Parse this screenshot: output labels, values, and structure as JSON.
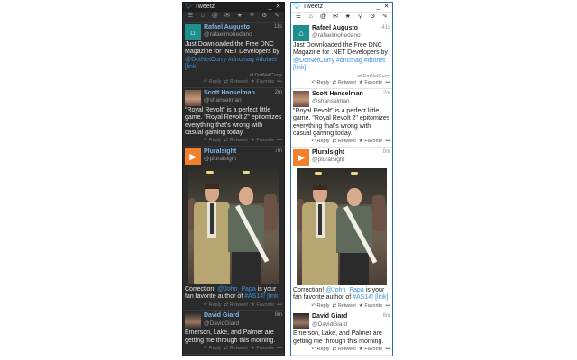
{
  "app": {
    "title": "Tweetz"
  },
  "titlebar": {
    "minimize_glyph": "_",
    "close_glyph": "✕"
  },
  "toolbar": {
    "icons": [
      "list-icon",
      "home-icon",
      "mentions-icon",
      "messages-icon",
      "favorites-icon",
      "search-icon",
      "settings-icon",
      "compose-icon"
    ]
  },
  "action_labels": {
    "reply": "Reply",
    "retweet": "Retweet",
    "favorite": "Favorite",
    "more": "•••"
  },
  "windows": [
    {
      "theme": "dark",
      "tweets": [
        {
          "name": "Rafael Augusto",
          "handle": "@rafaelmohedano",
          "time": "11s",
          "text_before": "Just Downloaded the Free DNC Magazine for .NET Developers by ",
          "link1": "@DotNetCurry #dncmag #dotnet",
          "link2": "[link]",
          "via": "DotNetCurry"
        },
        {
          "name": "Scott Hanselman",
          "handle": "@shanselman",
          "time": "2m",
          "text": "\"Royal Revolt\" is a perfect little game. \"Royal Revolt 2\" epitomizes everything that's wrong with casual gaming today."
        },
        {
          "name": "Pluralsight",
          "handle": "@pluralsight",
          "time": "7m",
          "text_before": "Correction! ",
          "link1": "@John_Papa",
          "text_middle": " is your fan favorite author of ",
          "link2": "#AS14! [link]"
        },
        {
          "name": "David Giard",
          "handle": "@DavidGiard",
          "time": "8m",
          "text": "Emerson, Lake, and Palmer are getting me through this morning."
        }
      ]
    },
    {
      "theme": "light",
      "tweets": [
        {
          "name": "Rafael Augusto",
          "handle": "@rafaelmohedano",
          "time": "41s",
          "text_before": "Just Downloaded the Free DNC Magazine for .NET Developers by ",
          "link1": "@DotNetCurry #dncmag #dotnet",
          "link2": "[link]",
          "via": "DotNetCurry"
        },
        {
          "name": "Scott Hanselman",
          "handle": "@shanselman",
          "time": "2m",
          "text": "\"Royal Revolt\" is a perfect little game. \"Royal Revolt 2\" epitomizes everything that's wrong with casual gaming today."
        },
        {
          "name": "Pluralsight",
          "handle": "@pluralsight",
          "time": "8m",
          "text_before": "Correction! ",
          "link1": "@John_Papa",
          "text_middle": " is your fan favorite author of ",
          "link2": "#AS14! [link]"
        },
        {
          "name": "David Giard",
          "handle": "@DavidGiard",
          "time": "8m",
          "text": "Emerson, Lake, and Palmer are getting me through this morning."
        }
      ]
    }
  ]
}
